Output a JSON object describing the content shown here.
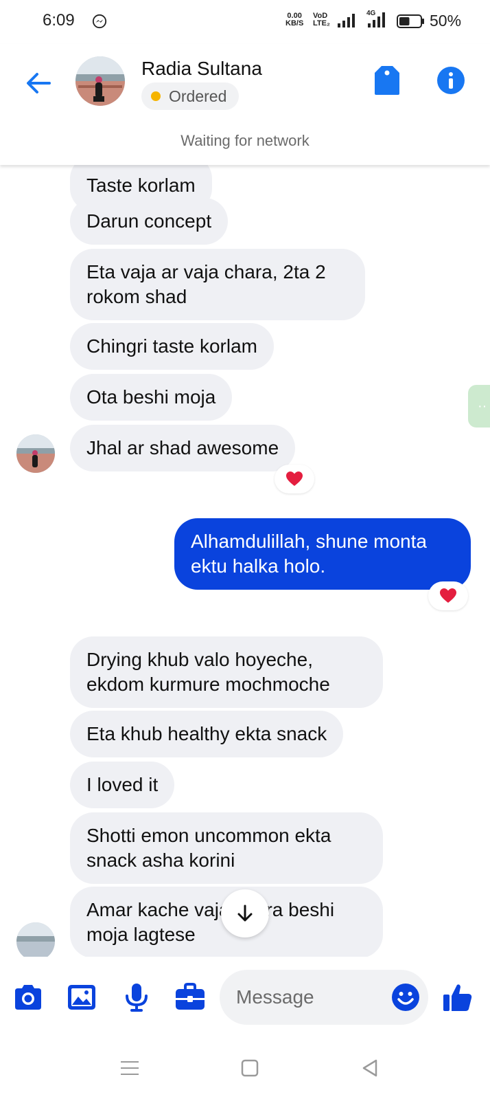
{
  "status_bar": {
    "time": "6:09",
    "speed_value": "0.00",
    "speed_unit": "KB/S",
    "volte_top": "VoD",
    "volte_bottom": "LTE₂",
    "network_type": "4G",
    "battery_percent": "50%",
    "battery_level": 0.5
  },
  "header": {
    "contact_name": "Radia Sultana",
    "order_status": "Ordered",
    "network_status": "Waiting for network"
  },
  "messages": [
    {
      "text": "Taste korlam",
      "direction": "incoming"
    },
    {
      "text": "Darun concept",
      "direction": "incoming"
    },
    {
      "text": "Eta vaja ar vaja chara, 2ta 2 rokom shad",
      "direction": "incoming"
    },
    {
      "text": "Chingri taste korlam",
      "direction": "incoming"
    },
    {
      "text": "Ota beshi moja",
      "direction": "incoming"
    },
    {
      "text": "Jhal ar shad awesome",
      "direction": "incoming",
      "reaction": "heart"
    },
    {
      "text": "Alhamdulillah, shune monta ektu halka holo.",
      "direction": "outgoing",
      "reaction": "heart"
    },
    {
      "text": "Drying khub valo hoyeche, ekdom kurmure mochmoche",
      "direction": "incoming"
    },
    {
      "text": "Eta khub healthy ekta snack",
      "direction": "incoming"
    },
    {
      "text": "I loved it",
      "direction": "incoming"
    },
    {
      "text": "Shotti emon uncommon ekta snack asha korini",
      "direction": "incoming"
    },
    {
      "text": "Amar kache vaja chara beshi moja lagtese",
      "direction": "incoming"
    }
  ],
  "composer": {
    "placeholder": "Message"
  },
  "icons": {
    "back": "arrow-left-icon",
    "tag": "tag-icon",
    "info": "info-icon",
    "camera": "camera-icon",
    "gallery": "image-icon",
    "mic": "microphone-icon",
    "toolbox": "briefcase-icon",
    "emoji": "emoji-icon",
    "like": "thumbs-up-icon",
    "scroll": "arrow-down-icon"
  },
  "colors": {
    "accent": "#0a43dd",
    "link_blue": "#1877f2",
    "incoming_bubble": "#eff0f4",
    "order_dot": "#f5b400",
    "reaction": "#e41e3f"
  }
}
